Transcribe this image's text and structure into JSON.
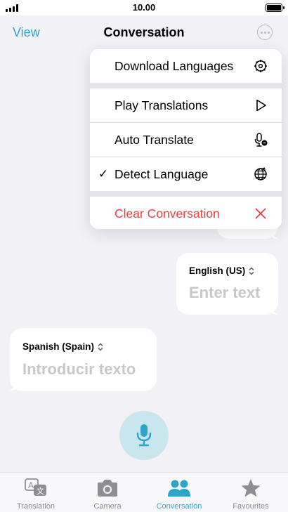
{
  "status_bar": {
    "time": "10.00",
    "signal_bars": 4,
    "battery_level": 1.0
  },
  "nav": {
    "view_label": "View",
    "title": "Conversation",
    "more_icon": "more-circle-icon"
  },
  "menu": {
    "items": [
      {
        "label": "Download Languages",
        "icon": "gear-icon",
        "checked": false
      },
      {
        "label": "Play Translations",
        "icon": "play-icon",
        "checked": false
      },
      {
        "label": "Auto Translate",
        "icon": "auto-translate-mic-icon",
        "checked": false
      },
      {
        "label": "Detect Language",
        "icon": "globe-icon",
        "checked": true,
        "check_mark": "✓"
      },
      {
        "label": "Clear Conversation",
        "icon": "close-icon",
        "checked": false,
        "destructive": true
      }
    ]
  },
  "bubbles": {
    "right": {
      "language": "English (US)",
      "placeholder": "Enter text"
    },
    "left": {
      "language": "Spanish (Spain)",
      "placeholder": "Introducir texto"
    }
  },
  "mic": {
    "icon": "microphone-icon"
  },
  "tabs": [
    {
      "label": "Translation",
      "icon": "translation-icon",
      "active": false
    },
    {
      "label": "Camera",
      "icon": "camera-icon",
      "active": false
    },
    {
      "label": "Conversation",
      "icon": "people-icon",
      "active": true
    },
    {
      "label": "Favourites",
      "icon": "star-icon",
      "active": false
    }
  ],
  "colors": {
    "accent": "#2fa4c9",
    "destructive": "#e84142",
    "inactive": "#8e8e93",
    "placeholder": "#c7c7cc",
    "background": "#f1f1f6"
  }
}
